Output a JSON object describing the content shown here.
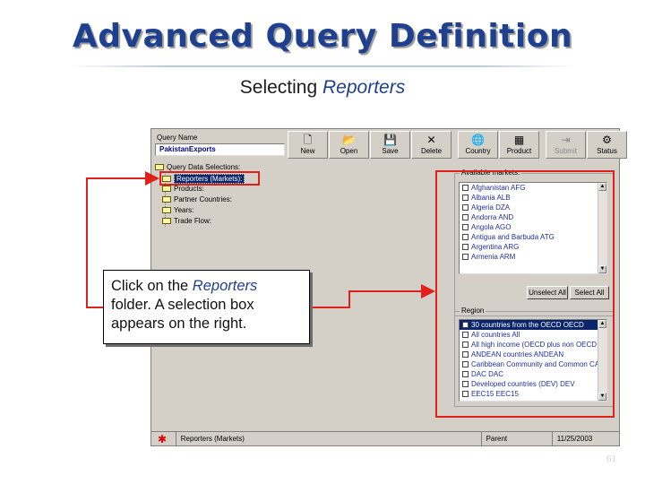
{
  "slide": {
    "title": "Advanced Query Definition",
    "subtitle_plain": "Selecting ",
    "subtitle_italic": "Reporters",
    "page_number": "61"
  },
  "callout": {
    "line1_plain": "Click on the ",
    "line1_italic": "Reporters",
    "rest": "folder. A selection box appears on the right."
  },
  "app": {
    "query_name_label": "Query Name",
    "query_name_value": "PakistanExports",
    "toolbar": [
      {
        "label": "New",
        "icon": "new-doc-icon",
        "glyph": "🗋"
      },
      {
        "label": "Open",
        "icon": "open-folder-icon",
        "glyph": "📂"
      },
      {
        "label": "Save",
        "icon": "save-disk-icon",
        "glyph": "💾"
      },
      {
        "label": "Delete",
        "icon": "delete-x-icon",
        "glyph": "✕"
      },
      {
        "label": "Country",
        "icon": "globe-icon",
        "glyph": "🌐"
      },
      {
        "label": "Product",
        "icon": "product-icon",
        "glyph": "▦"
      },
      {
        "label": "Submit",
        "icon": "submit-icon",
        "glyph": "⇥"
      },
      {
        "label": "Status",
        "icon": "gear-icon",
        "glyph": "⚙"
      }
    ],
    "tree": {
      "root": "Query Data Selections:",
      "items": [
        "Reporters (Markets):",
        "Products:",
        "Partner Countries:",
        "Years:",
        "Trade Flow:"
      ]
    },
    "available": {
      "label": "Available markets:",
      "rows": [
        "Afghanistan AFG",
        "Albania ALB",
        "Algeria DZA",
        "Andorra AND",
        "Angola AGO",
        "Antigua and Barbuda ATG",
        "Argentina ARG",
        "Armenia ARM"
      ],
      "unselect_all": "Unselect All",
      "select_all": "Select All"
    },
    "regions": {
      "label": "Region",
      "rows": [
        "30 countries from the OECD OECD",
        "All countries All",
        "All high income (OECD plus non OECD",
        "ANDEAN countries ANDEAN",
        "Caribbean Community and Common CAR",
        "DAC DAC",
        "Developed countries (DEV) DEV",
        "EEC15 EEC15"
      ]
    },
    "status": {
      "text": "Reporters (Markets)",
      "parent": "Parent",
      "date": "11/25/2003"
    }
  },
  "colors": {
    "title": "#1f3f8f",
    "highlight_red": "#e0201b",
    "selection_navy": "#0a246a"
  }
}
